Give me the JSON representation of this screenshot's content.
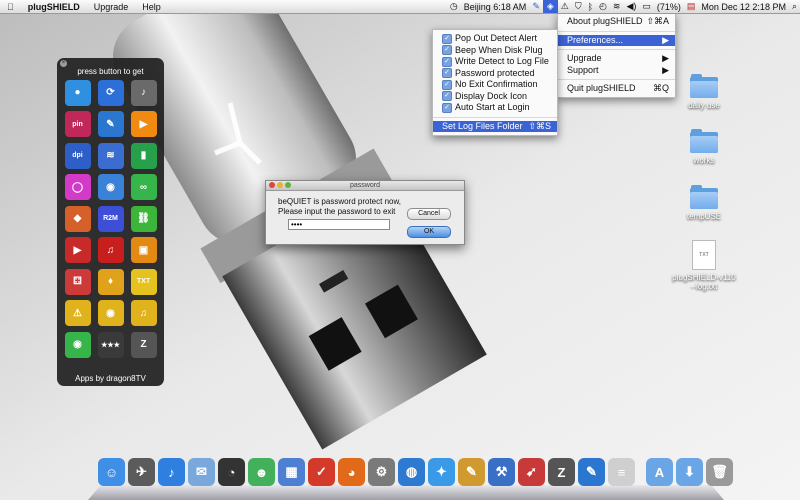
{
  "menubar": {
    "apple_icon": "apple-icon",
    "app_name": "plugSHIELD",
    "menus": [
      "Upgrade",
      "Help"
    ],
    "clock_city": "Beijing 6:18 AM",
    "battery": "(71%)",
    "date_time": "Mon Dec 12  2:18 PM"
  },
  "app_menu": {
    "items": [
      {
        "label": "About plugSHIELD",
        "shortcut": "⇧⌘A"
      },
      {
        "label": "Preferences...",
        "shortcut": "▶"
      },
      {
        "label": "Upgrade",
        "shortcut": "▶"
      },
      {
        "label": "Support",
        "shortcut": "▶"
      },
      {
        "label": "Quit plugSHIELD",
        "shortcut": "⌘Q"
      }
    ]
  },
  "prefs_menu": {
    "options": [
      {
        "label": "Pop Out Detect Alert",
        "checked": true
      },
      {
        "label": "Beep When Disk Plug",
        "checked": true
      },
      {
        "label": "Write Detect to Log File",
        "checked": true
      },
      {
        "label": "Password protected",
        "checked": true
      },
      {
        "label": "No Exit Confirmation",
        "checked": true
      },
      {
        "label": "Display Dock Icon",
        "checked": true
      },
      {
        "label": "Auto Start at Login",
        "checked": true
      }
    ],
    "action": {
      "label": "Set Log Files Folder",
      "shortcut": "⇧⌘S"
    }
  },
  "launcher": {
    "title": "press button to get",
    "footer": "Apps by dragon8TV",
    "apps": [
      {
        "name": "drop-icon",
        "glyph": "●",
        "color": "#2f8fe0"
      },
      {
        "name": "sync-icon",
        "glyph": "⟳",
        "color": "#2d6fd8"
      },
      {
        "name": "music-icon",
        "glyph": "♪",
        "color": "#6a6a6a"
      },
      {
        "name": "pinyin-icon",
        "glyph": "pin",
        "color": "#c0285a"
      },
      {
        "name": "usb-pen-icon",
        "glyph": "✎",
        "color": "#2b77cf"
      },
      {
        "name": "play-icon",
        "glyph": "▶",
        "color": "#f08a10"
      },
      {
        "name": "dpi-icon",
        "glyph": "dpi",
        "color": "#2e5ec7"
      },
      {
        "name": "wifi-icon",
        "glyph": "≋",
        "color": "#3b6cd0"
      },
      {
        "name": "battery-icon",
        "glyph": "▮",
        "color": "#27a04c"
      },
      {
        "name": "ring-icon",
        "glyph": "◯",
        "color": "#d43ac8"
      },
      {
        "name": "eye-plus-icon",
        "glyph": "◉",
        "color": "#3a82d8"
      },
      {
        "name": "links-icon",
        "glyph": "∞",
        "color": "#35b54a"
      },
      {
        "name": "pieces-icon",
        "glyph": "◆",
        "color": "#d5602a"
      },
      {
        "name": "r2m-icon",
        "glyph": "R2M",
        "color": "#3c4fd6"
      },
      {
        "name": "chain-icon",
        "glyph": "⛓",
        "color": "#3db43a"
      },
      {
        "name": "truck-icon",
        "glyph": "▶",
        "color": "#c82a2a"
      },
      {
        "name": "headphone-icon",
        "glyph": "♫",
        "color": "#c81e1e"
      },
      {
        "name": "orange-icon",
        "glyph": "▣",
        "color": "#e38a14"
      },
      {
        "name": "dice-icon",
        "glyph": "⚃",
        "color": "#cc3a3a"
      },
      {
        "name": "cards-icon",
        "glyph": "♦",
        "color": "#e0a21a"
      },
      {
        "name": "txt-icon",
        "glyph": "TXT",
        "color": "#e6c21e"
      },
      {
        "name": "warning-icon",
        "glyph": "⚠",
        "color": "#e0b21b"
      },
      {
        "name": "eye-warning-icon",
        "glyph": "◉",
        "color": "#e0b21b"
      },
      {
        "name": "headset-icon",
        "glyph": "♫",
        "color": "#e0b21b"
      },
      {
        "name": "eye-icon",
        "glyph": "◉",
        "color": "#35b54a"
      },
      {
        "name": "stars-icon",
        "glyph": "★★★",
        "color": "#3a3a3a"
      },
      {
        "name": "z-icon",
        "glyph": "Z",
        "color": "#555555"
      }
    ]
  },
  "dialog": {
    "window_title": "password",
    "message": "beQUIET is password protect now,\nPlease input the password to exit",
    "password_value": "••••",
    "cancel_label": "Cancel",
    "ok_label": "OK"
  },
  "desktop": {
    "items": [
      {
        "label": "daily use",
        "kind": "folder"
      },
      {
        "label": "works",
        "kind": "folder"
      },
      {
        "label": "tempUSE",
        "kind": "folder"
      },
      {
        "label": "plugSHIELD-v110--log.txt",
        "kind": "document",
        "badge": "TXT"
      }
    ]
  },
  "dock": {
    "items": [
      {
        "name": "finder-icon",
        "glyph": "☺",
        "color": "#3f8fe6"
      },
      {
        "name": "launchpad-icon",
        "glyph": "✈",
        "color": "#5b5b5b"
      },
      {
        "name": "itunes-icon",
        "glyph": "♪",
        "color": "#2f7fe0"
      },
      {
        "name": "mail-icon",
        "glyph": "✉",
        "color": "#7aa7dc"
      },
      {
        "name": "dashboard-icon",
        "glyph": "◔",
        "color": "#333333"
      },
      {
        "name": "messenger-icon",
        "glyph": "☻",
        "color": "#43b05c"
      },
      {
        "name": "preview-icon",
        "glyph": "▦",
        "color": "#4d7fd3"
      },
      {
        "name": "calendar-icon",
        "glyph": "✓",
        "color": "#d33a2a"
      },
      {
        "name": "firefox-icon",
        "glyph": "◕",
        "color": "#e06a1a"
      },
      {
        "name": "system-preferences-icon",
        "glyph": "⚙",
        "color": "#7a7a7a"
      },
      {
        "name": "earth-icon",
        "glyph": "◍",
        "color": "#2e7ad0"
      },
      {
        "name": "safari-icon",
        "glyph": "✦",
        "color": "#3a9ae8"
      },
      {
        "name": "pen-app-icon",
        "glyph": "✎",
        "color": "#d09a30"
      },
      {
        "name": "xcode-icon",
        "glyph": "⚒",
        "color": "#3a6fc6"
      },
      {
        "name": "rocket-icon",
        "glyph": "➹",
        "color": "#c83a3a"
      },
      {
        "name": "z-app-icon",
        "glyph": "Z",
        "color": "#555555"
      },
      {
        "name": "usb-app-icon",
        "glyph": "✎",
        "color": "#2b77cf"
      },
      {
        "name": "textedit-icon",
        "glyph": "≡",
        "color": "#cfcfcf"
      },
      {
        "name": "applications-folder-icon",
        "glyph": "A",
        "color": "#6aa5e6"
      },
      {
        "name": "downloads-folder-icon",
        "glyph": "⬇",
        "color": "#6aa5e6"
      },
      {
        "name": "trash-icon",
        "glyph": "🗑",
        "color": "#9a9a9a"
      }
    ]
  }
}
